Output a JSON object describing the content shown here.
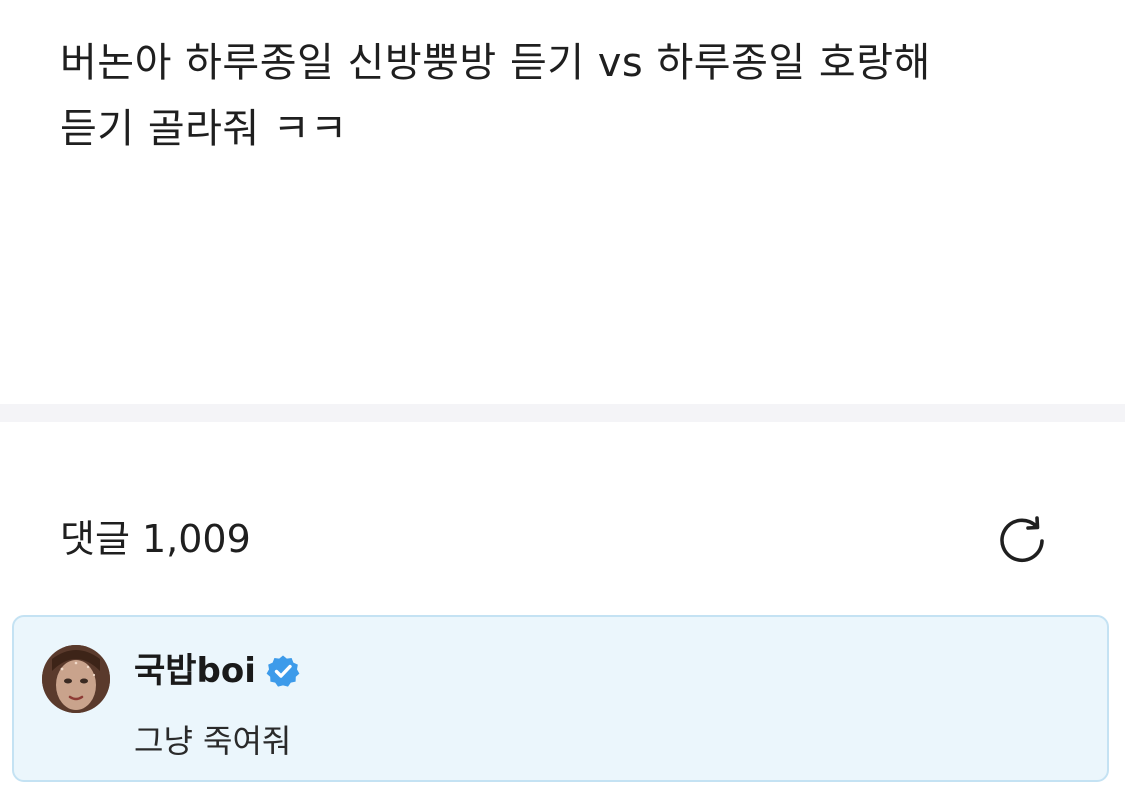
{
  "post": {
    "body": "버논아 하루종일 신방뿡방 듣기 vs 하루종일 호랑해\n듣기 골라줘 ㅋㅋ"
  },
  "comments": {
    "title": "댓글 1,009",
    "refresh_icon": "refresh-icon",
    "items": [
      {
        "author": "국밥boi",
        "verified": true,
        "verified_icon": "verified-badge-icon",
        "text": "그냥 죽여줘"
      }
    ]
  },
  "colors": {
    "comment_card_bg": "#ebf6fc",
    "comment_card_border": "#c4e2f3",
    "verified_blue": "#3d9bea",
    "divider": "#f4f4f7"
  }
}
